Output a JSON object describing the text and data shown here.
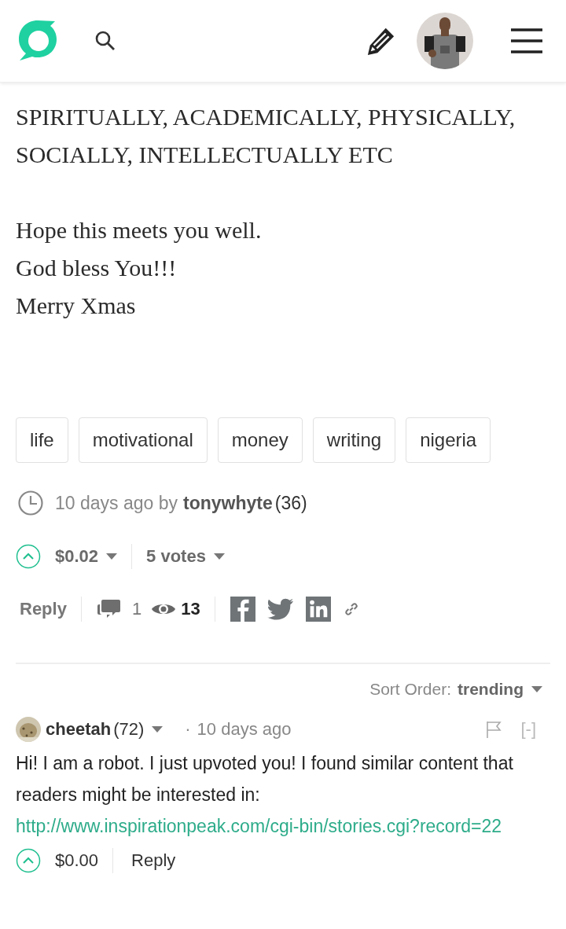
{
  "post": {
    "paragraphs": [
      [
        "SPIRITUALLY, ACADEMICALLY, PHYSICALLY, SOCIALLY, INTELLECTUALLY ETC"
      ],
      [
        "Hope this meets you well.",
        "God bless You!!!",
        "Merry Xmas"
      ]
    ]
  },
  "tags": [
    "life",
    "motivational",
    "money",
    "writing",
    "nigeria"
  ],
  "meta": {
    "time": "10 days ago by",
    "author": "tonywhyte",
    "reputation": "(36)"
  },
  "votes": {
    "payout": "$0.02",
    "count": "5 votes"
  },
  "actions": {
    "reply": "Reply",
    "comments": "1",
    "views": "13"
  },
  "sort": {
    "label": "Sort Order:",
    "value": "trending"
  },
  "comment": {
    "author": "cheetah",
    "reputation": "(72)",
    "separator": "·",
    "time": "10 days ago",
    "collapse": "[-]",
    "body": "Hi! I am a robot. I just upvoted you! I found similar content that readers might be interested in:",
    "link": "http://www.inspirationpeak.com/cgi-bin/stories.cgi?record=22",
    "payout": "$0.00",
    "reply": "Reply"
  }
}
